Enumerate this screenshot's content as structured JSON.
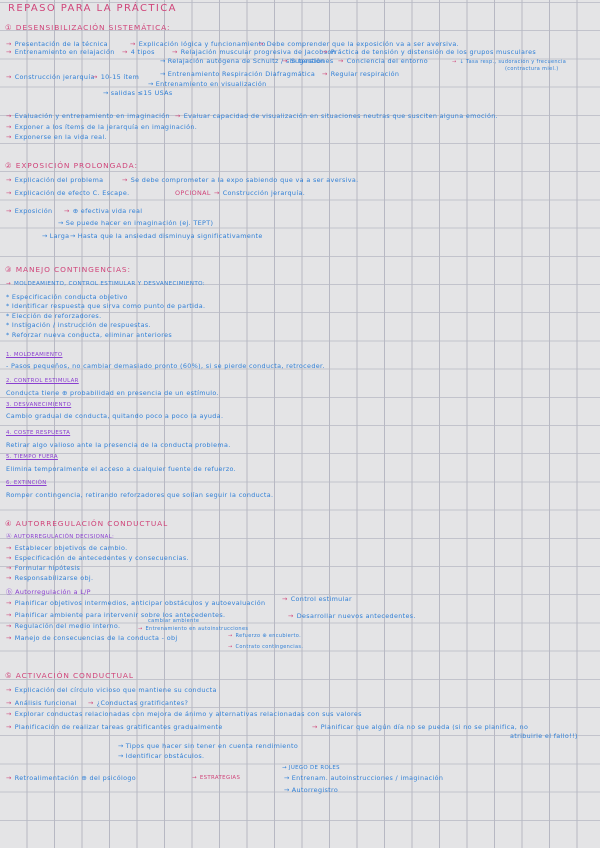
{
  "title": "Repaso para la práctica",
  "s1": {
    "header": "① Desensibilización sistemática:",
    "l": [
      "Presentación de la técnica",
      "Explicación lógica y funcionamiento",
      "Debe comprender que la exposición va a ser aversiva.",
      "Entrenamiento en relajación",
      "4 tipos",
      "Relajación muscular progresiva de Jacobson",
      "Práctica de tensión y distensión de los grupos musculares",
      "Relajación autógena de Schultz / sin tensión",
      "Sugestiones",
      "Conciencia del entorno",
      "↓ Tasa resp., sudoración y frecuencia",
      "(contractura miel.)",
      "Construcción jerarquía",
      "10-15 ítem",
      "Entrenamiento Respiración Diafragmática",
      "Regular respiración",
      "Entrenamiento en visualización",
      "salidas ≤15 USAs",
      "Evaluación y entrenamiento en imaginación",
      "Evaluar capacidad de visualización en situaciones neutras que susciten alguna emoción.",
      "Exponer a los ítems de la jerarquía en imaginación.",
      "Exponerse en la vida real."
    ]
  },
  "s2": {
    "header": "② Exposición prolongada:",
    "l": [
      "Explicación del problema",
      "Se debe comprometer a la expo sabiendo que va a ser aversiva.",
      "Explicación de efecto C. Escape.",
      "OPCIONAL",
      "Construcción jerarquía.",
      "Exposición",
      "⊕ efectiva vida real",
      "Se puede hacer en imaginación (ej. TEPT)",
      "Larga",
      "Hasta que la ansiedad disminuya significativamente"
    ]
  },
  "s3": {
    "header": "③ Manejo contingencias:",
    "l": [
      "Moldeamiento, control estimular y desvanecimiento:",
      "* Especificación conducta objetivo",
      "* Identificar respuesta que sirva como punto de partida.",
      "* Elección de reforzadores.",
      "* Instigación / instrucción de respuestas.",
      "* Reforzar nueva conducta, eliminar anteriores",
      "1. Moldeamiento",
      "- Pasos pequeños, no cambiar demasiado pronto (60%), si se pierde conducta, retroceder.",
      "2. Control estimular",
      "Conducta tiene ⊕ probabilidad en presencia de un estímulo.",
      "3. Desvanecimiento",
      "Cambio gradual de conducta, quitando poco a poco la ayuda.",
      "4. Coste respuesta",
      "Retirar algo valioso ante la presencia de la conducta problema.",
      "5. Tiempo fuera",
      "Elimina temporalmente el acceso a cualquier fuente de refuerzo.",
      "6. Extinción",
      "Romper contingencia, retirando reforzadores que solían seguir la conducta."
    ]
  },
  "s4": {
    "header": "④ Autorregulación conductual",
    "l": [
      "ⓐ Autorregulación decisional:",
      "Establecer objetivos de cambio.",
      "Especificación de antecedentes y consecuencias.",
      "Formular hipótesis",
      "Responsabilizarse obj.",
      "ⓑ Autorregulación a L/P",
      "Planificar objetivos intermedios, anticipar obstáculos y autoevaluación",
      "Control estimular",
      "Planificar ambiente para intervenir sobre los antecedentes.",
      "Desarrollar nuevos antecedentes.",
      "Regulación del medio interno.",
      "cambiar ambiente",
      "Entrenamiento en autoinstrucciones",
      "Manejo de consecuencias de la conducta - obj",
      "Refuerzo ⊕ encubierto.",
      "Contrato contingencias."
    ]
  },
  "s5": {
    "header": "⑤ Activación conductual",
    "l": [
      "Explicación del círculo vicioso que mantiene su conducta",
      "Análisis funcional",
      "¿Conductas gratificantes?",
      "Explorar conductas relacionadas con mejora de ánimo y alternativas relacionadas con sus valores",
      "Planificación de realizar tareas gratificantes gradualmente",
      "Planificar que algún día no se pueda (si no se planifica, no",
      "atribuirle el fallo!!)",
      "Tipos que hacer sin tener en cuenta rendimiento",
      "Identificar obstáculos.",
      "Juego de roles",
      "Retroalimentación ⊕ del psicólogo",
      "Estrategias",
      "Entrenam. autoinstrucciones / imaginación",
      "Autorregistro"
    ]
  }
}
